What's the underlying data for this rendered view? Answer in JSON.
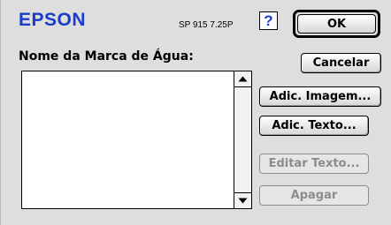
{
  "header": {
    "logo": "EPSON",
    "model": "SP 915 7.25P",
    "help_label": "?"
  },
  "form": {
    "label": "Nome da Marca de Água:",
    "list_items": []
  },
  "buttons": {
    "ok": "OK",
    "cancel": "Cancelar",
    "add_image": "Adic. Imagem...",
    "add_text": "Adic. Texto...",
    "edit_text": "Editar Texto...",
    "delete": "Apagar"
  },
  "colors": {
    "brand": "#1a3cc8",
    "disabled_text": "#8c8c8c"
  },
  "icons": {
    "help": "question-mark-icon",
    "scroll_up": "arrow-up-icon",
    "scroll_down": "arrow-down-icon"
  }
}
